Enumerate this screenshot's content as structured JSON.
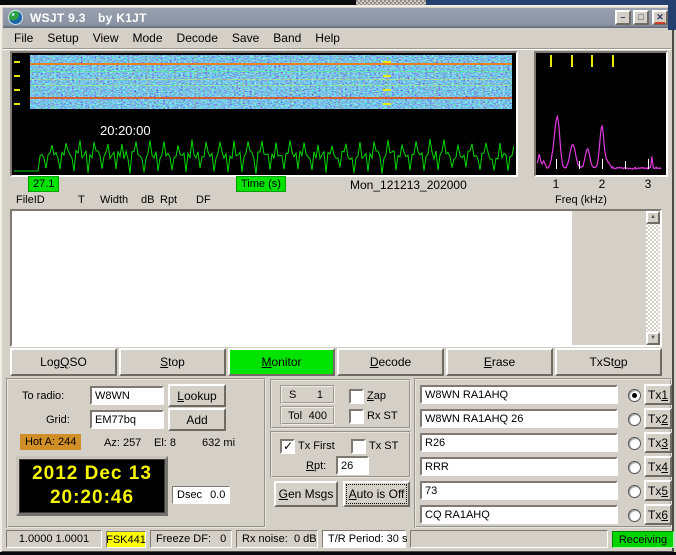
{
  "window": {
    "title_app": "WSJT 9.3",
    "title_byline": "by K1JT"
  },
  "titlebar_icons": {
    "app": "globe",
    "minimize": "–",
    "maximize": "□",
    "close": "✕"
  },
  "icons": {
    "checkmark": "✓",
    "scroll_up": "▲",
    "scroll_down": "▼"
  },
  "menu": {
    "items": [
      "File",
      "Setup",
      "View",
      "Mode",
      "Decode",
      "Save",
      "Band",
      "Help"
    ]
  },
  "waterfall": {
    "clip_time": "20:20:00",
    "level_badge": "27.1",
    "axis_badge": "Time (s)",
    "file_id": "Mon_121213_202000"
  },
  "spectrum": {
    "tick_labels": [
      "1",
      "2",
      "3"
    ],
    "axis_label": "Freq (kHz)",
    "tone_marker_color": "#e8e800",
    "trace_color": "#e23ae2"
  },
  "decode_panel": {
    "columns": [
      "FileID",
      "T",
      "Width",
      "dB",
      "Rpt",
      "DF"
    ],
    "text": ""
  },
  "actions": {
    "log_qso": "Log [Q]SO",
    "stop": "[S]top",
    "monitor": "[M]onitor",
    "decode": "[D]ecode",
    "erase": "[E]rase",
    "txstop": "TxSt[o]p",
    "monitor_active": true
  },
  "station": {
    "to_radio_label": "To radio:",
    "to_radio_value": "W8WN",
    "grid_label": "Grid:",
    "grid_value": "EM77bq",
    "lookup_label": "[L]ookup",
    "add_label": "Add",
    "hot_badge": "Hot A: 244",
    "azimuth": "Az: 257",
    "elevation": "El: 8",
    "distance": "632 mi",
    "clock_date": "2012 Dec 13",
    "clock_time": "20:20:46",
    "dsec_label": "Dsec",
    "dsec_value": "0.0"
  },
  "params": {
    "sync_label": "S",
    "sync_value": "1",
    "tol_label": "Tol",
    "tol_value": "400",
    "zap_label": "[Z]ap",
    "zap_checked": false,
    "rx_st_label": "Rx ST",
    "rx_st_checked": false,
    "tx_first_label": "Tx First",
    "tx_first_checked": true,
    "tx_st_label": "Tx ST",
    "tx_st_checked": false,
    "rpt_label": "[R]pt:",
    "rpt_value": "26",
    "gen_msgs_label": "[G]en Msgs",
    "auto_label": "[A]uto is Off"
  },
  "tx_messages": [
    {
      "text": "W8WN RA1AHQ",
      "button": "Tx[1]",
      "selected": true
    },
    {
      "text": "W8WN RA1AHQ 26",
      "button": "Tx[2]",
      "selected": false
    },
    {
      "text": "R26",
      "button": "Tx[3]",
      "selected": false
    },
    {
      "text": "RRR",
      "button": "Tx[4]",
      "selected": false
    },
    {
      "text": "73",
      "button": "Tx[5]",
      "selected": false
    },
    {
      "text": "CQ RA1AHQ",
      "button": "Tx[6]",
      "selected": false
    }
  ],
  "status": {
    "rate_ratio": "1.0000 1.0001",
    "mode": "FSK441",
    "freeze_df": "Freeze DF:   0",
    "rx_noise": "Rx noise:  0 dB",
    "tr_period": "T/R Period: 30 s",
    "state": "Receiving",
    "receiving_active": true
  },
  "colors": {
    "window_face": "#d4d0c8",
    "titlebar": "#8f96a4",
    "active_green": "#00e300",
    "receiving_green": "#00d400",
    "mode_yellow": "#ffff00",
    "hot_amber": "#d18f28",
    "clock_yellow": "#f6f600",
    "waveform_green": "#00d800",
    "spectrum_magenta": "#e23ae2",
    "tone_marker_yellow": "#e8e800"
  }
}
